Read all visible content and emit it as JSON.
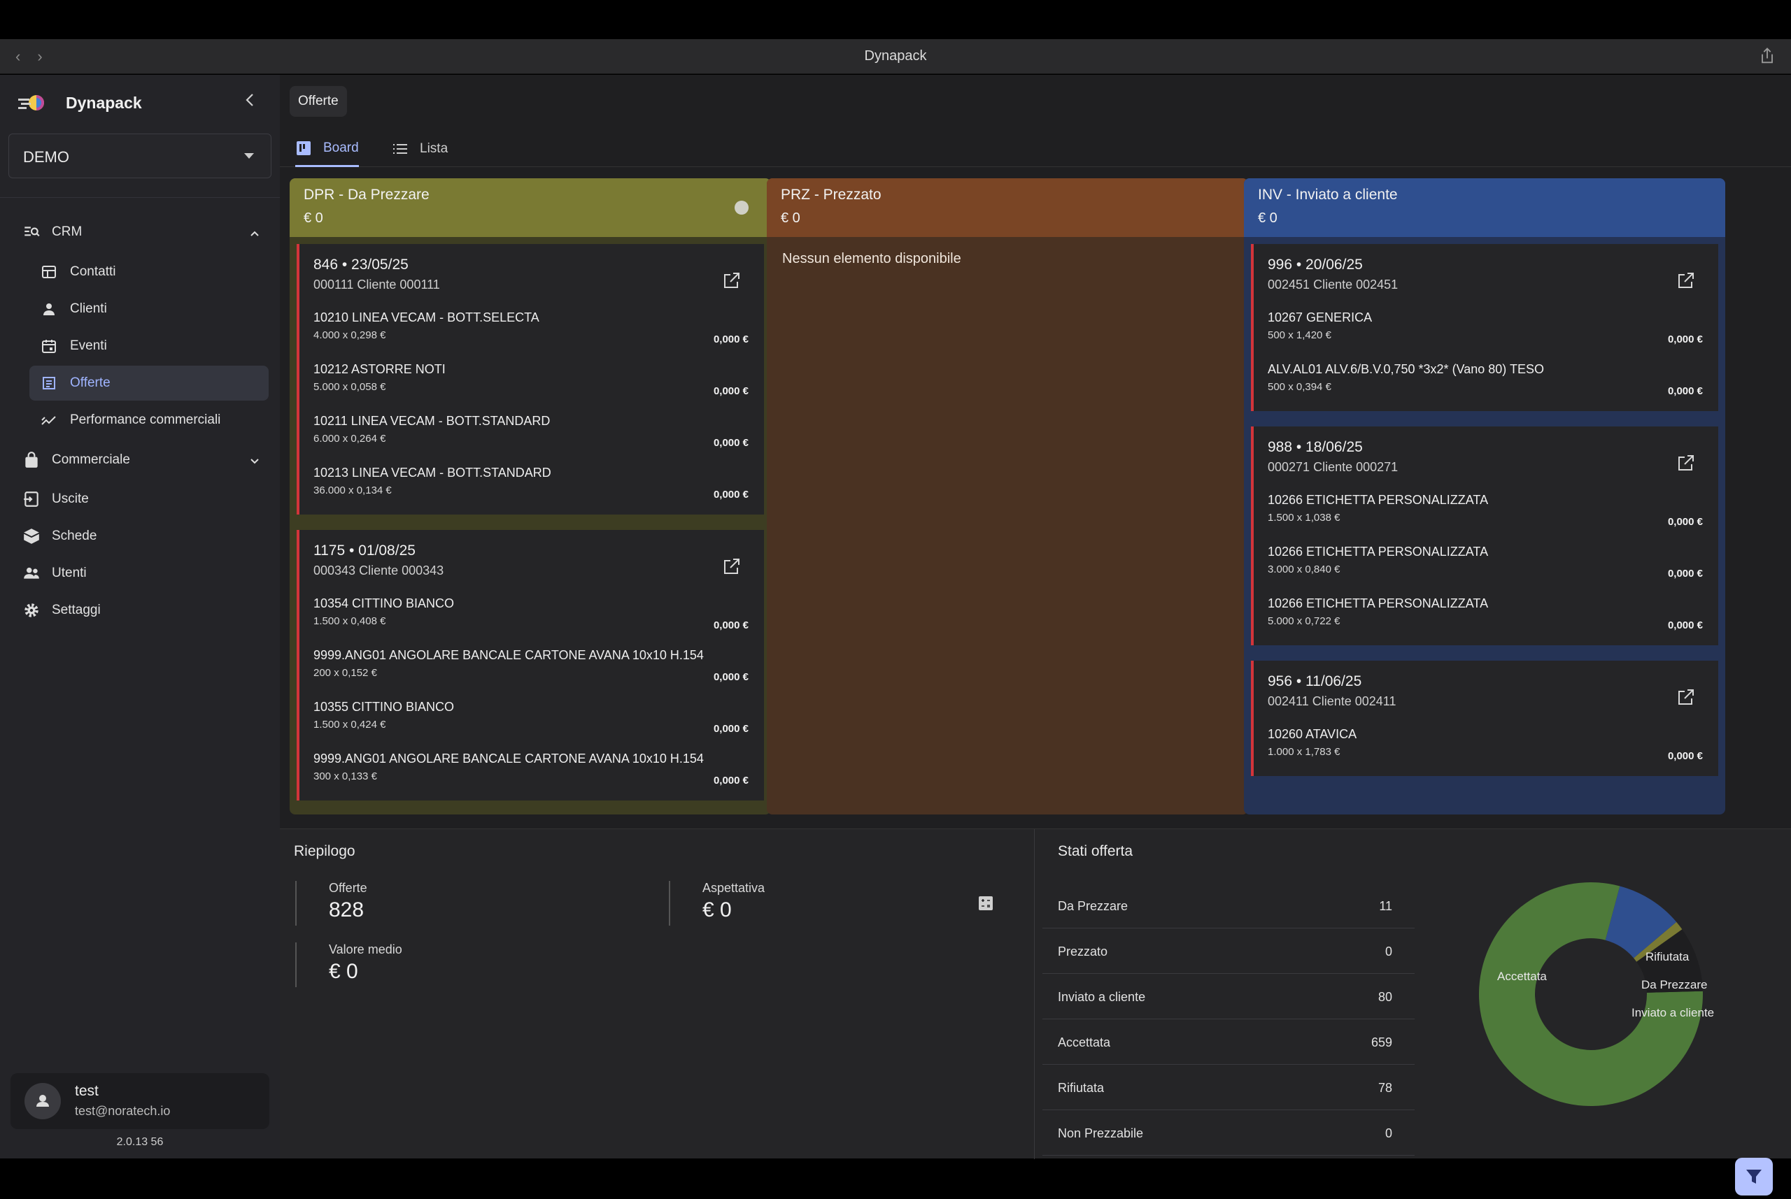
{
  "window": {
    "title": "Dynapack",
    "back": "‹",
    "forward": "›"
  },
  "sidebar": {
    "brand": "Dynapack",
    "company": "DEMO",
    "items": [
      {
        "label": "CRM",
        "icon": "crm-search-icon"
      },
      {
        "label": "Contatti",
        "icon": "contacts-icon"
      },
      {
        "label": "Clienti",
        "icon": "person-icon"
      },
      {
        "label": "Eventi",
        "icon": "calendar-icon"
      },
      {
        "label": "Offerte",
        "icon": "offers-icon"
      },
      {
        "label": "Performance commerciali",
        "icon": "trend-icon"
      },
      {
        "label": "Commerciale",
        "icon": "bag-icon"
      },
      {
        "label": "Uscite",
        "icon": "exit-icon"
      },
      {
        "label": "Schede",
        "icon": "box-icon"
      },
      {
        "label": "Utenti",
        "icon": "users-icon"
      },
      {
        "label": "Settaggi",
        "icon": "gear-icon"
      }
    ],
    "user": {
      "name": "test",
      "email": "test@noratech.io"
    },
    "version": "2.0.13 56"
  },
  "page": {
    "chip": "Offerte",
    "tabs": [
      {
        "label": "Board"
      },
      {
        "label": "Lista"
      }
    ]
  },
  "columns": [
    {
      "title": "DPR - Da Prezzare",
      "total": "€ 0",
      "color": "#7a7a33",
      "cards": [
        {
          "header": "846 • 23/05/25",
          "client": "000111 Cliente 000111",
          "lines": [
            {
              "desc": "10210 LINEA VECAM - BOTT.SELECTA",
              "qty": "4.000  x  0,298 €",
              "total": "0,000 €"
            },
            {
              "desc": "10212 ASTORRE NOTI",
              "qty": "5.000  x  0,058 €",
              "total": "0,000 €"
            },
            {
              "desc": "10211 LINEA VECAM - BOTT.STANDARD",
              "qty": "6.000  x  0,264 €",
              "total": "0,000 €"
            },
            {
              "desc": "10213 LINEA VECAM - BOTT.STANDARD",
              "qty": "36.000  x  0,134 €",
              "total": "0,000 €"
            }
          ]
        },
        {
          "header": "1175 • 01/08/25",
          "client": "000343 Cliente 000343",
          "lines": [
            {
              "desc": "10354 CITTINO BIANCO",
              "qty": "1.500  x  0,408 €",
              "total": "0,000 €"
            },
            {
              "desc": "9999.ANG01 ANGOLARE BANCALE CARTONE AVANA 10x10 H.154",
              "qty": "200  x  0,152 €",
              "total": "0,000 €"
            },
            {
              "desc": "10355 CITTINO BIANCO",
              "qty": "1.500  x  0,424 €",
              "total": "0,000 €"
            },
            {
              "desc": "9999.ANG01 ANGOLARE BANCALE CARTONE AVANA 10x10 H.154",
              "qty": "300  x  0,133 €",
              "total": "0,000 €"
            }
          ]
        }
      ]
    },
    {
      "title": "PRZ - Prezzato",
      "total": "€ 0",
      "color": "#7a4525",
      "empty": "Nessun elemento disponibile",
      "cards": []
    },
    {
      "title": "INV - Inviato a cliente",
      "total": "€ 0",
      "color": "#2f4f8f",
      "cards": [
        {
          "header": "996 • 20/06/25",
          "client": "002451 Cliente 002451",
          "lines": [
            {
              "desc": "10267 GENERICA",
              "qty": "500  x  1,420 €",
              "total": "0,000 €"
            },
            {
              "desc": "ALV.AL01 ALV.6/B.V.0,750 *3x2* (Vano 80) TESO",
              "qty": "500  x  0,394 €",
              "total": "0,000 €"
            }
          ]
        },
        {
          "header": "988 • 18/06/25",
          "client": "000271 Cliente 000271",
          "lines": [
            {
              "desc": "10266 ETICHETTA PERSONALIZZATA",
              "qty": "1.500  x  1,038 €",
              "total": "0,000 €"
            },
            {
              "desc": "10266 ETICHETTA PERSONALIZZATA",
              "qty": "3.000  x  0,840 €",
              "total": "0,000 €"
            },
            {
              "desc": "10266 ETICHETTA PERSONALIZZATA",
              "qty": "5.000  x  0,722 €",
              "total": "0,000 €"
            }
          ]
        },
        {
          "header": "956 • 11/06/25",
          "client": "002411 Cliente 002411",
          "lines": [
            {
              "desc": "10260 ATAVICA",
              "qty": "1.000  x  1,783 €",
              "total": "0,000 €"
            }
          ]
        }
      ]
    }
  ],
  "summary": {
    "title": "Riepilogo",
    "offerte_label": "Offerte",
    "offerte_value": "828",
    "aspettativa_label": "Aspettativa",
    "aspettativa_value": "€ 0",
    "valore_medio_label": "Valore medio",
    "valore_medio_value": "€ 0"
  },
  "states": {
    "title": "Stati offerta",
    "rows": [
      {
        "label": "Da Prezzare",
        "value": "11"
      },
      {
        "label": "Prezzato",
        "value": "0"
      },
      {
        "label": "Inviato a cliente",
        "value": "80"
      },
      {
        "label": "Accettata",
        "value": "659"
      },
      {
        "label": "Rifiutata",
        "value": "78"
      },
      {
        "label": "Non Prezzabile",
        "value": "0"
      }
    ],
    "pie": [
      {
        "label": "Accettata",
        "value": 659,
        "color": "#4e7a3a"
      },
      {
        "label": "Rifiutata",
        "value": 78,
        "color": "#1e1e20"
      },
      {
        "label": "Da Prezzare",
        "value": 11,
        "color": "#7a7a33"
      },
      {
        "label": "Inviato a cliente",
        "value": 80,
        "color": "#2f4f8f"
      }
    ]
  }
}
